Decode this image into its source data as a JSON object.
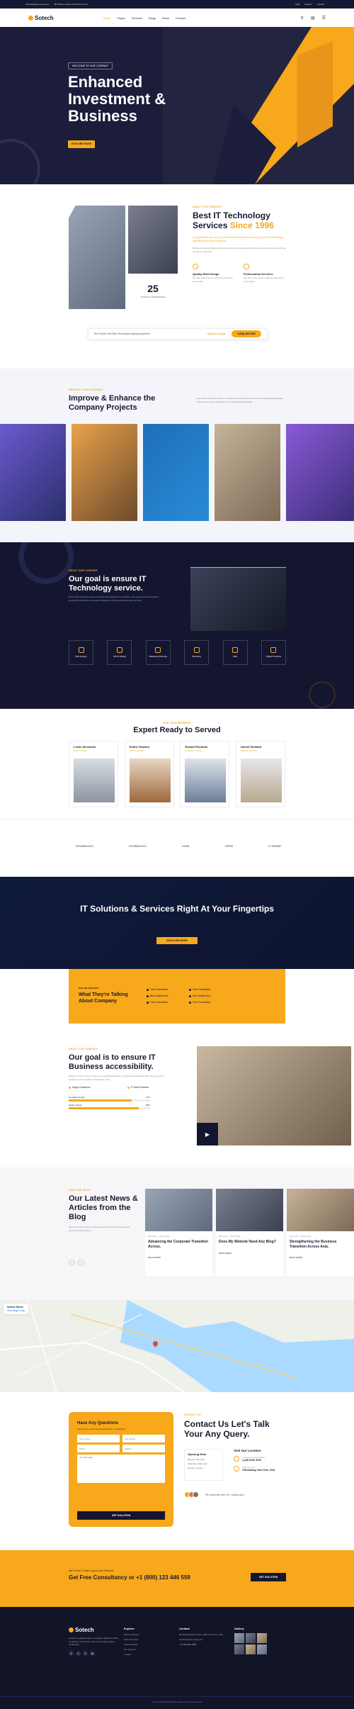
{
  "topbar": {
    "email": "needhelp@company.com",
    "address": "88 Broklyn Golden Street New York",
    "links": [
      "Help",
      "Support",
      "Contact"
    ]
  },
  "header": {
    "logo": "Sotech",
    "nav": [
      "Home",
      "Pages",
      "Services",
      "Blogs",
      "News",
      "Contact"
    ],
    "icons": [
      "search-icon",
      "cart-icon",
      "menu-icon"
    ]
  },
  "hero": {
    "tag": "WELCOME TO OUR COMPANY",
    "title": "Enhanced Investment & Business",
    "button": "EXPLORE MORE"
  },
  "about": {
    "tag": "ABOUT OUR COMPANY",
    "title_a": "Best IT Technology Services ",
    "title_b": "Since 1996",
    "lead": "Our specialists are here to put the well-known tech tools to your best & Technology optimal at best use throughout",
    "body": "Build user-focused digital experiences and smart integrations that drive growth and scale enterprise operations efficiently.",
    "years_num": "25",
    "years_label": "YEARS OF EXPERIENCE",
    "feature1_title": "Quality Web Design",
    "feature1_text": "We offer end-to-end IT solutions tailored to your needs.",
    "feature2_title": "Professional Services",
    "feature2_text": "We offer end-to-end IT solutions tailored to your needs.",
    "bar_text": "We Provide Full Office Renovation Anything anywhere.",
    "bar_link": "Request a Quote",
    "bar_phone": "+(308) 456-7890"
  },
  "improve": {
    "tag": "IMPROVE YOUR BUSINESS",
    "title": "Improve & Enhance the Company Projects",
    "text": "We provide a diverse array of company and solutions to meet the ever-expanding demands. Whether you require assistance with data specific specialty."
  },
  "goal": {
    "tag": "ABOUT OUR COMPANY",
    "title": "Our goal is ensure IT Technology service.",
    "text": "We provide a diverse array of services and solutions to streamline your operations and enhance productivity. Whether you require assistance with the enterprise-level services.",
    "services": [
      "Web Design",
      "UI/UX Design",
      "Marketing Planning",
      "Branding",
      "SEO",
      "Digital Products"
    ]
  },
  "team": {
    "tag": "OUR TEAM MEMBERS",
    "title": "Expert Ready to Served",
    "members": [
      {
        "name": "Leslie Alexander",
        "role": "Bisg. Founder"
      },
      {
        "name": "Esther Howard",
        "role": "CFE Consultant"
      },
      {
        "name": "Ronald Richards",
        "role": "President of Sales"
      },
      {
        "name": "Darrell Steward",
        "role": "Medical Assistant"
      }
    ]
  },
  "brands": [
    "STARBUCKS",
    "STARBUCKS",
    "STAR",
    "OPEN",
    "X-TREME"
  ],
  "cta": {
    "title": "IT Solutions & Services Right At Your Fingertips",
    "button": "DISCOVER MORE"
  },
  "talking": {
    "tag": "WHY WE ARE BEST",
    "title": "What They're Talking About Company",
    "checks": [
      "Free Consultation",
      "Best Quality Work",
      "Free Consultation",
      "Free Consultation",
      "Best Quality Work",
      "Free Consultation"
    ]
  },
  "access": {
    "tag": "ABOUT OUR COMPANY",
    "title": "Our goal is to ensure IT Business accessibility.",
    "text": "System is a term used to refer to an organized collection symbols and processes that may be used to operate on such symbols. Perspiciatis unde.",
    "check1": "Happy Customers",
    "check2": "IT World Services",
    "bar1_label": "Complete Project",
    "bar1_value": "77%",
    "bar1_fill": 0.77,
    "bar2_label": "Happy Clients",
    "bar2_value": "86%",
    "bar2_fill": 0.86
  },
  "blog": {
    "tag": "NEWS AND BLOG",
    "title": "Our Latest News & Articles from the Blog",
    "text": "We are provide a full innovative and trustworthy crafting a unique story with solid success.",
    "posts": [
      {
        "author": "By Admin",
        "cat": "Technology",
        "title": "Advancing the Corporate Transition Across.",
        "more": "READ MORE"
      },
      {
        "author": "By Admin",
        "cat": "Technology",
        "title": "Does My Website Need Any Blog?",
        "more": "READ MORE"
      },
      {
        "author": "By Admin",
        "cat": "Technology",
        "title": "Strengthening the Business Transition Across Asia.",
        "more": "READ MORE"
      }
    ]
  },
  "map": {
    "place": "Sotech Street",
    "link": "View larger map"
  },
  "contact": {
    "form_title": "Have Any Questions",
    "form_sub": "Feel free to contact us through Twitter or Facebook",
    "name_ph": "Your Name",
    "email_ph": "Your Email",
    "phone_ph": "Phone",
    "subject_ph": "Subject",
    "message_ph": "Your Message",
    "submit": "GET SOLUTION",
    "tag": "CONTACT US",
    "title": "Contact Us Let's Talk Your Any Query.",
    "hours_title": "Opening Hour",
    "hours": [
      "Mon-Fri: 9am-6pm",
      "Saturday: 10am-4pm",
      "Sunday: Closed"
    ],
    "loc_title": "Visit Our Location",
    "phone_label": "Looking for Consultation",
    "phone": "1-(45) 0000 3019",
    "addr_label": "Address Line",
    "addr": "3 Broadway, New York, USA",
    "trust": "We collaborate with 100+ leading apps"
  },
  "consult": {
    "small": "We're here to help to grow your business",
    "title": "Get Free Consultancy or +1 (800) 123 446 559",
    "button": "GET SOLUTION"
  },
  "footer": {
    "logo": "Sotech",
    "about": "Sotech is a global leader of strategic digital and data consulting, with clients in all of the world's largest companies.",
    "explore_title": "Explore",
    "explore": [
      "About Company",
      "Meet The Team",
      "News & Media",
      "Our Projects",
      "Contact"
    ],
    "contact_title": "Contact",
    "contact": [
      "80 Broad Broklyn Street, 2000 New York, USA",
      "needhelp@company.com",
      "+91 888 888 8888"
    ],
    "gallery_title": "Gallery",
    "copyright": "© Copyright 2024 All rights reserved by company.com"
  },
  "colors": {
    "accent": "#f7a81b",
    "navy": "#141630"
  }
}
